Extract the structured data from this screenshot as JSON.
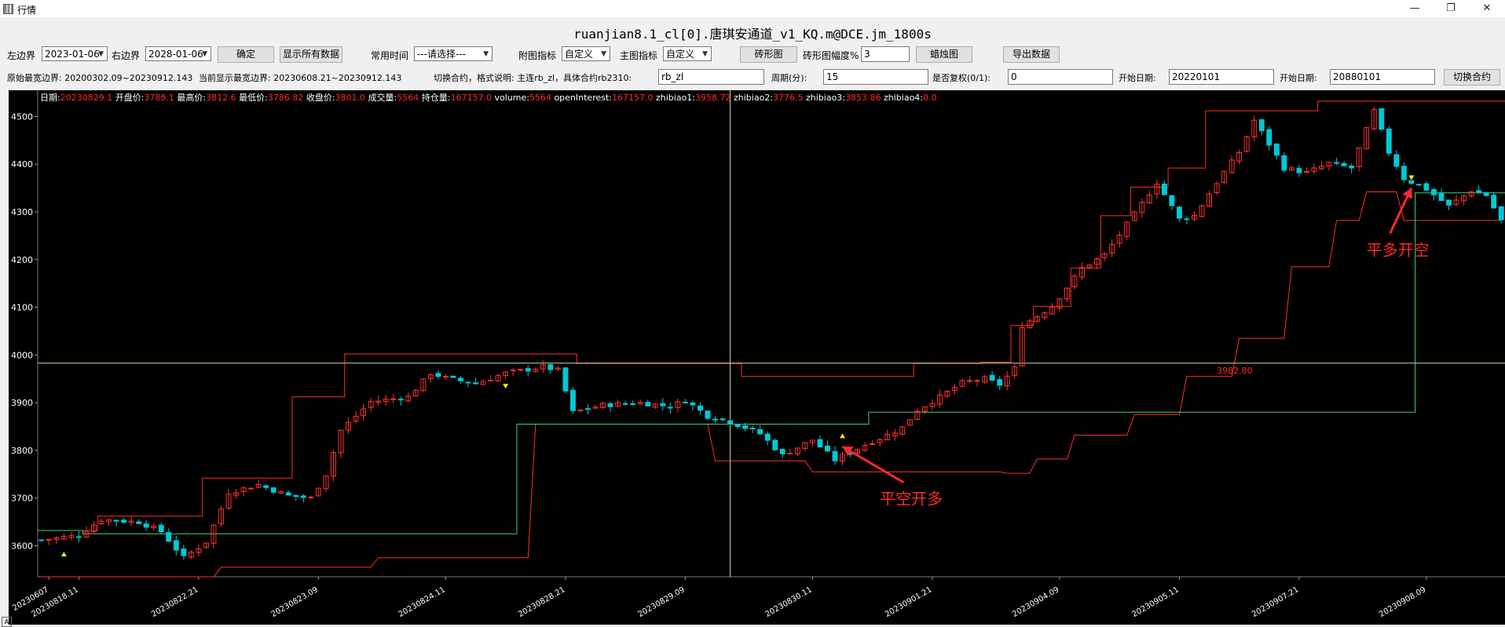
{
  "window": {
    "title": "行情",
    "app_icon": "bars-icon"
  },
  "chart_title": "ruanjian8.1_cl[0].唐琪安通道_v1_KQ.m@DCE.jm_1800s",
  "toolbar1": {
    "left_bound_label": "左边界",
    "left_bound_value": "2023-01-06",
    "right_bound_label": "右边界",
    "right_bound_value": "2028-01-06",
    "confirm_button": "确定",
    "show_all_button": "显示所有数据",
    "common_time_label": "常用时间",
    "common_time_value": "---请选择---",
    "sub_indicator_label": "附图指标",
    "sub_indicator_value": "自定义",
    "main_indicator_label": "主图指标",
    "main_indicator_value": "自定义",
    "brick_button": "砖形图",
    "brick_amp_label": "砖形图幅度%",
    "brick_amp_value": "3",
    "candle_button": "蜡烛图",
    "export_button": "导出数据"
  },
  "toolbar2": {
    "original_bound_text": "原始最宽边界: 20200302.09~20230912.143",
    "current_bound_text": "当前显示最宽边界: 20230608.21~20230912.143",
    "switch_desc_label": "切换合约，格式说明: 主连rb_zl，具体合约rb2310:",
    "contract_value": "rb_zl",
    "period_label": "周期(分):",
    "period_value": "15",
    "reweight_label": "是否复权(0/1):",
    "reweight_value": "0",
    "start_date_label": "开始日期:",
    "start_date_value": "20220101",
    "end_date_label": "开始日期:",
    "end_date_value": "20880101",
    "switch_button": "切换合约"
  },
  "info_bar": [
    {
      "label": "日期:",
      "value": "20230829.1"
    },
    {
      "label": "开盘价:",
      "value": "3788.1"
    },
    {
      "label": "最高价:",
      "value": "3812.6"
    },
    {
      "label": "最低价:",
      "value": "3786.82"
    },
    {
      "label": "收盘价:",
      "value": "3801.0"
    },
    {
      "label": "成交量:",
      "value": "5564"
    },
    {
      "label": "持仓量:",
      "value": "167157.0"
    },
    {
      "label": "volume:",
      "value": "5564"
    },
    {
      "label": "openInterest:",
      "value": "167157.0"
    },
    {
      "label": "zhibiao1:",
      "value": "3958.72"
    },
    {
      "label": "zhibiao2:",
      "value": "3776.5"
    },
    {
      "label": "zhibiao3:",
      "value": "3853.86"
    },
    {
      "label": "zhibiao4:",
      "value": "0.0"
    }
  ],
  "colors": {
    "background": "#000000",
    "up": "#ff3030",
    "down": "#00c8d6",
    "upper_band": "#ff3020",
    "lower_band": "#ff3020",
    "mid_line": "#ff3a30",
    "signal_line": "#3cd679",
    "crosshair": "#c8d8a0",
    "info_label": "#ffffff",
    "info_value": "#ff2a2a",
    "annotation": "#ff2a2a",
    "marker": "#ffe600"
  },
  "chart_data": {
    "type": "candlestick",
    "ylim": [
      3535,
      4555
    ],
    "yticks": [
      3600,
      3700,
      3800,
      3900,
      4000,
      4100,
      4200,
      4300,
      4400,
      4500
    ],
    "n_bars": 196,
    "xticks": [
      {
        "index": 1,
        "label": "20230607"
      },
      {
        "index": 5,
        "label": "20230818.11"
      },
      {
        "index": 21,
        "label": "20230822.21"
      },
      {
        "index": 37,
        "label": "20230823.09"
      },
      {
        "index": 54,
        "label": "20230824.11"
      },
      {
        "index": 70,
        "label": "20230828.21"
      },
      {
        "index": 86,
        "label": "20230829.09"
      },
      {
        "index": 103,
        "label": "20230830.11"
      },
      {
        "index": 119,
        "label": "20230901.21"
      },
      {
        "index": 136,
        "label": "20230904.09"
      },
      {
        "index": 152,
        "label": "20230905.11"
      },
      {
        "index": 168,
        "label": "20230907.21"
      },
      {
        "index": 185,
        "label": "20230908.09"
      }
    ],
    "close_anchors": [
      [
        0,
        3612
      ],
      [
        5,
        3622
      ],
      [
        8,
        3655
      ],
      [
        13,
        3650
      ],
      [
        16,
        3630
      ],
      [
        19,
        3575
      ],
      [
        22,
        3608
      ],
      [
        25,
        3712
      ],
      [
        29,
        3728
      ],
      [
        33,
        3705
      ],
      [
        36,
        3700
      ],
      [
        38,
        3750
      ],
      [
        40,
        3842
      ],
      [
        44,
        3902
      ],
      [
        49,
        3912
      ],
      [
        52,
        3962
      ],
      [
        54,
        3952
      ],
      [
        58,
        3940
      ],
      [
        62,
        3962
      ],
      [
        67,
        3975
      ],
      [
        69,
        3968
      ],
      [
        71,
        3880
      ],
      [
        75,
        3895
      ],
      [
        80,
        3900
      ],
      [
        84,
        3892
      ],
      [
        86,
        3905
      ],
      [
        89,
        3872
      ],
      [
        92,
        3860
      ],
      [
        96,
        3835
      ],
      [
        99,
        3790
      ],
      [
        103,
        3822
      ],
      [
        106,
        3780
      ],
      [
        110,
        3812
      ],
      [
        113,
        3832
      ],
      [
        115,
        3848
      ],
      [
        117,
        3885
      ],
      [
        120,
        3912
      ],
      [
        123,
        3942
      ],
      [
        126,
        3950
      ],
      [
        128,
        3938
      ],
      [
        130,
        3972
      ],
      [
        131,
        4062
      ],
      [
        135,
        4102
      ],
      [
        139,
        4182
      ],
      [
        142,
        4210
      ],
      [
        146,
        4295
      ],
      [
        149,
        4362
      ],
      [
        152,
        4285
      ],
      [
        154,
        4292
      ],
      [
        157,
        4362
      ],
      [
        160,
        4425
      ],
      [
        162,
        4492
      ],
      [
        166,
        4392
      ],
      [
        169,
        4382
      ],
      [
        172,
        4402
      ],
      [
        175,
        4392
      ],
      [
        178,
        4512
      ],
      [
        180,
        4425
      ],
      [
        182,
        4370
      ],
      [
        185,
        4348
      ],
      [
        188,
        4312
      ],
      [
        191,
        4345
      ],
      [
        193,
        4335
      ],
      [
        195,
        4282
      ]
    ],
    "upper_band_steps": [
      [
        0,
        3632
      ],
      [
        8,
        3662
      ],
      [
        22,
        3742
      ],
      [
        34,
        3912
      ],
      [
        41,
        4002
      ],
      [
        72,
        3982
      ],
      [
        94,
        3955
      ],
      [
        117,
        3982
      ],
      [
        126,
        3985
      ],
      [
        130,
        4062
      ],
      [
        133,
        4102
      ],
      [
        138,
        4182
      ],
      [
        142,
        4292
      ],
      [
        146,
        4352
      ],
      [
        151,
        4392
      ],
      [
        156,
        4512
      ],
      [
        171,
        4532
      ]
    ],
    "lower_band_steps": [
      [
        0,
        3535
      ],
      [
        24,
        3555
      ],
      [
        45,
        3575
      ],
      [
        66,
        3855
      ],
      [
        90,
        3778
      ],
      [
        103,
        3755
      ],
      [
        129,
        3752
      ],
      [
        133,
        3782
      ],
      [
        138,
        3832
      ],
      [
        146,
        3875
      ],
      [
        153,
        3955
      ],
      [
        160,
        4035
      ],
      [
        167,
        4185
      ],
      [
        173,
        4282
      ],
      [
        177,
        4342
      ],
      [
        182,
        4282
      ]
    ],
    "signal_line_steps": [
      [
        0,
        3632
      ],
      [
        6,
        3625
      ],
      [
        63,
        3625
      ],
      [
        64,
        3855
      ],
      [
        110,
        3855
      ],
      [
        111,
        3880
      ],
      [
        183,
        3880
      ],
      [
        184,
        4340
      ]
    ],
    "hline": {
      "y": 3982.8,
      "label": "3982.80"
    },
    "crosshair_index": 92,
    "markers": [
      {
        "index": 3,
        "direction": "up",
        "price": 3582
      },
      {
        "index": 62,
        "direction": "down",
        "price": 3935
      },
      {
        "index": 107,
        "direction": "up",
        "price": 3830
      },
      {
        "index": 183,
        "direction": "down",
        "price": 4372
      }
    ],
    "annotations": [
      {
        "text": "平多开空",
        "index": 177,
        "price": 4222,
        "arrow_to_index": 183,
        "arrow_to_price": 4350
      },
      {
        "text": "平空开多",
        "index": 112,
        "price": 3700,
        "arrow_to_index": 107,
        "arrow_to_price": 3808
      }
    ]
  }
}
